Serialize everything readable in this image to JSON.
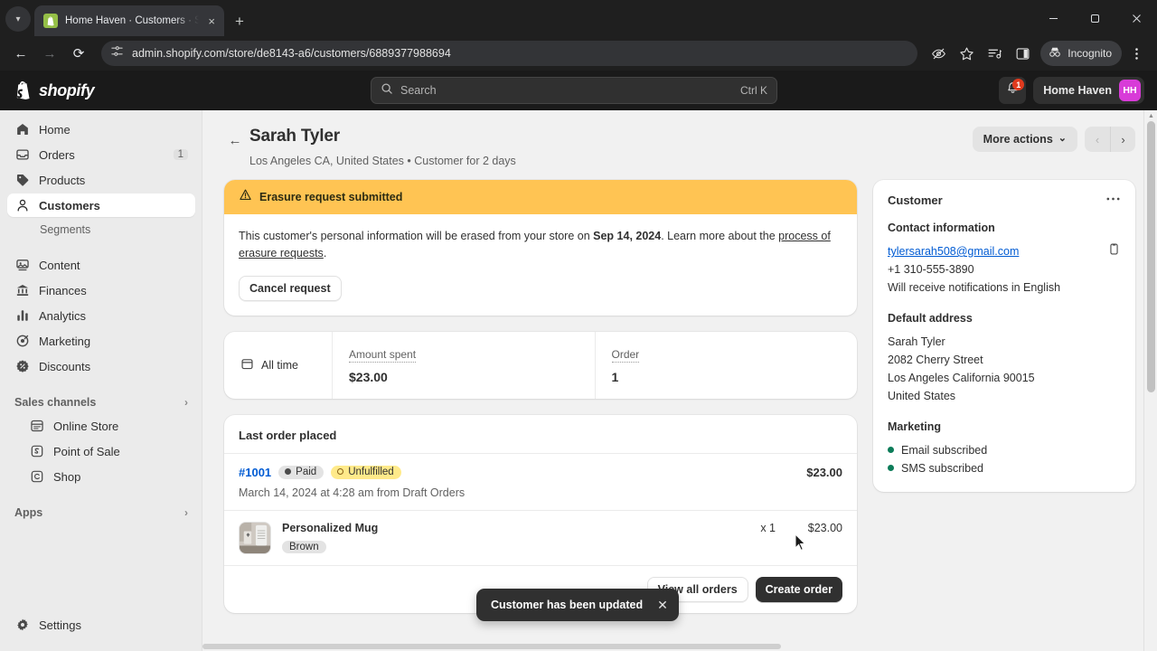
{
  "browser": {
    "tab": {
      "title": "Home Haven · Customers · Sara",
      "favicon": "shopify-favicon",
      "close": "×"
    },
    "newtab_label": "+",
    "window": {
      "minimize": "—",
      "maximize": "▢",
      "close": "✕"
    },
    "nav": {
      "back": "←",
      "forward": "→",
      "reload": "⟳"
    },
    "url": "admin.shopify.com/store/de8143-a6/customers/6889377988694",
    "incognito_label": "Incognito",
    "icons": [
      "site-settings-icon",
      "hide-password-icon",
      "bookmark-star-icon",
      "reading-list-icon",
      "side-panel-icon",
      "incognito-icon",
      "browser-menu-icon"
    ]
  },
  "topbar": {
    "brand": "shopify",
    "search": {
      "placeholder": "Search",
      "shortcut": "Ctrl K"
    },
    "notifications_count": "1",
    "store_name": "Home Haven",
    "store_initials": "HH"
  },
  "sidebar": {
    "items": [
      {
        "label": "Home",
        "icon": "home-icon",
        "count": ""
      },
      {
        "label": "Orders",
        "icon": "orders-icon",
        "count": "1"
      },
      {
        "label": "Products",
        "icon": "products-tag-icon",
        "count": ""
      },
      {
        "label": "Customers",
        "icon": "customers-person-icon",
        "count": "",
        "active": true
      }
    ],
    "sub_item": "Segments",
    "items2": [
      {
        "label": "Content",
        "icon": "content-icon"
      },
      {
        "label": "Finances",
        "icon": "finances-bank-icon"
      },
      {
        "label": "Analytics",
        "icon": "analytics-bars-icon"
      },
      {
        "label": "Marketing",
        "icon": "marketing-target-icon"
      },
      {
        "label": "Discounts",
        "icon": "discounts-icon"
      }
    ],
    "sales_channels_label": "Sales channels",
    "channels": [
      {
        "label": "Online Store",
        "icon": "online-store-icon"
      },
      {
        "label": "Point of Sale",
        "icon": "point-of-sale-icon"
      },
      {
        "label": "Shop",
        "icon": "shop-icon"
      }
    ],
    "apps_label": "Apps",
    "settings_label": "Settings",
    "chevron": "›"
  },
  "page": {
    "back_arrow": "←",
    "title": "Sarah Tyler",
    "subtitle": "Los Angeles CA, United States • Customer for 2 days",
    "more_actions_label": "More actions",
    "chevron_down": "⌄",
    "pager_prev": "‹",
    "pager_next": "›"
  },
  "banner": {
    "title": "Erasure request submitted",
    "icon": "warning-triangle-icon",
    "text_before": "This customer's personal information will be erased from your store on ",
    "date": "Sep 14, 2024",
    "text_middle": ". Learn more about the ",
    "link": "process of erasure requests",
    "text_after": ".",
    "cancel_label": "Cancel request",
    "color": "#ffc453"
  },
  "stats": {
    "all_time_label": "All time",
    "calendar_icon": "calendar-icon",
    "cells": [
      {
        "label": "Amount spent",
        "value": "$23.00"
      },
      {
        "label": "Order",
        "value": "1"
      }
    ]
  },
  "last_order": {
    "card_title": "Last order placed",
    "order_id": "#1001",
    "payment_status": "Paid",
    "fulfillment_status": "Unfulfilled",
    "amount": "$23.00",
    "meta": "March 14, 2024 at 4:28 am from Draft Orders",
    "line_items": [
      {
        "name": "Personalized Mug",
        "variant": "Brown",
        "qty": "x 1",
        "price": "$23.00"
      }
    ],
    "view_all_label": "View all orders",
    "create_order_label": "Create order"
  },
  "customer_panel": {
    "title": "Customer",
    "more_icon": "ellipsis-icon",
    "contact_title": "Contact information",
    "email": "tylersarah508@gmail.com",
    "copy_icon": "copy-icon",
    "phone": "+1 310-555-3890",
    "notifications_note": "Will receive notifications in English",
    "address_title": "Default address",
    "address_lines": [
      "Sarah Tyler",
      "2082 Cherry Street",
      "Los Angeles California 90015",
      "United States"
    ],
    "marketing_title": "Marketing",
    "marketing": [
      {
        "label": "Email subscribed",
        "color": "#0c7c59"
      },
      {
        "label": "SMS subscribed",
        "color": "#0c7c59"
      }
    ]
  },
  "toast": {
    "message": "Customer has been updated",
    "close": "✕"
  }
}
